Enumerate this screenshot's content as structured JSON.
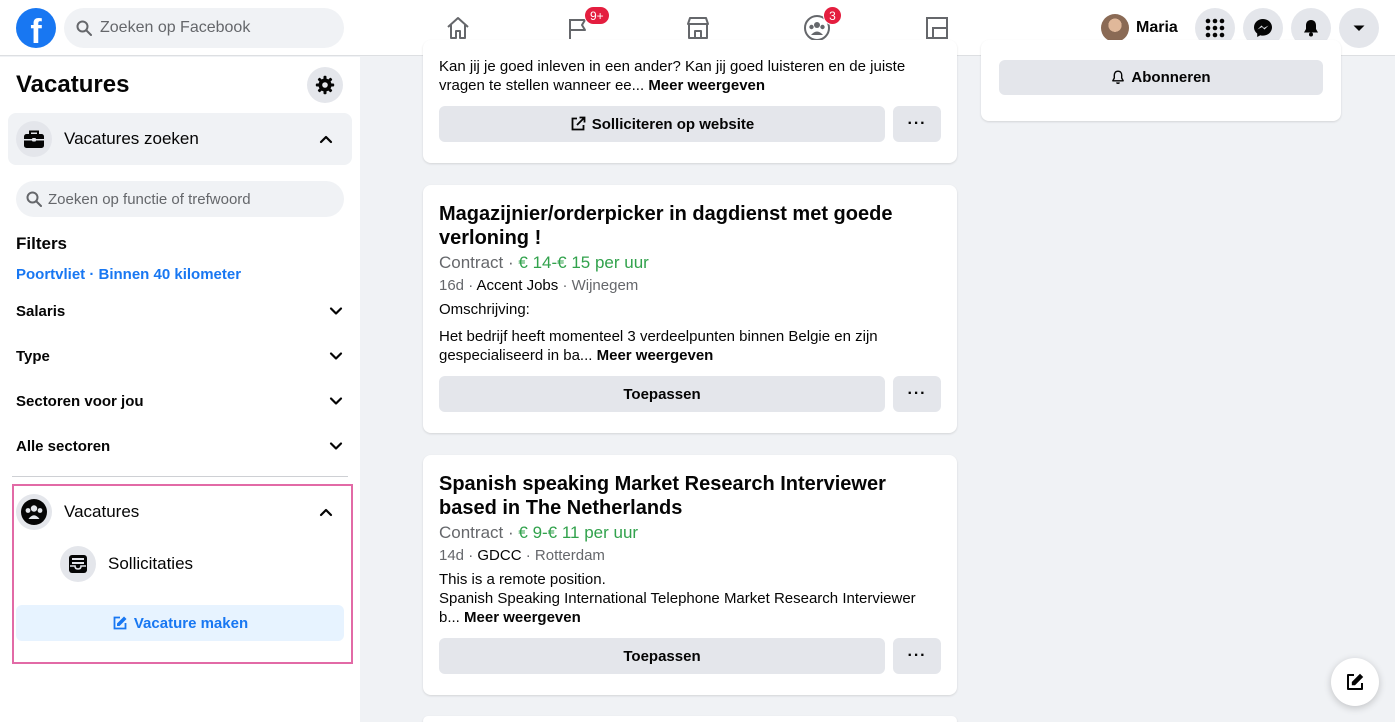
{
  "topbar": {
    "logo_letter": "f",
    "search_placeholder": "Zoeken op Facebook",
    "nav": [
      {
        "name": "home",
        "badge": ""
      },
      {
        "name": "pages",
        "badge": "9+"
      },
      {
        "name": "marketplace",
        "badge": ""
      },
      {
        "name": "groups",
        "badge": "3"
      },
      {
        "name": "gaming",
        "badge": ""
      }
    ],
    "profile_name": "Maria"
  },
  "sidebar": {
    "title": "Vacatures",
    "search_jobs_label": "Vacatures zoeken",
    "search_placeholder": "Zoeken op functie of trefwoord",
    "filters_heading": "Filters",
    "location": "Poortvliet · Binnen 40 kilometer",
    "filters": [
      "Salaris",
      "Type",
      "Sectoren voor jou",
      "Alle sectoren"
    ],
    "my_jobs_label": "Vacatures",
    "applications_label": "Sollicitaties",
    "create_job_label": "Vacature maken"
  },
  "feed": {
    "partial_card": {
      "desc_text": "Kan jij je goed inleven in een ander? Kan jij goed luisteren en de juiste vragen te stellen wanneer ee...",
      "more_label": "Meer weergeven",
      "apply_label": "Solliciteren op website"
    },
    "jobs": [
      {
        "title": "Magazijnier/orderpicker in dagdienst met goede verloning !",
        "type": "Contract",
        "separator": "·",
        "salary": "€ 14-€ 15 per uur",
        "age": "16d",
        "company": "Accent Jobs",
        "location": "Wijnegem",
        "desc_line1": "Omschrijving:",
        "desc_text": "Het bedrijf heeft momenteel 3 verdeelpunten binnen Belgie en zijn gespecialiseerd in ba...",
        "more_label": "Meer weergeven",
        "apply_label": "Toepassen"
      },
      {
        "title": "Spanish speaking Market Research Interviewer based in The Netherlands",
        "type": "Contract",
        "separator": "·",
        "salary": "€ 9-€ 11 per uur",
        "age": "14d",
        "company": "GDCC",
        "location": "Rotterdam",
        "desc_line1": "This is a remote position.",
        "desc_text": "Spanish Speaking International Telephone Market Research Interviewer b...",
        "more_label": "Meer weergeven",
        "apply_label": "Toepassen"
      }
    ],
    "more_options_label": "···"
  },
  "right_panel": {
    "subscribe_label": "Abonneren"
  },
  "colors": {
    "brand": "#1877f2",
    "salary": "#31a24c",
    "badge": "#e41e3f",
    "highlight_border": "#e26aa6"
  }
}
